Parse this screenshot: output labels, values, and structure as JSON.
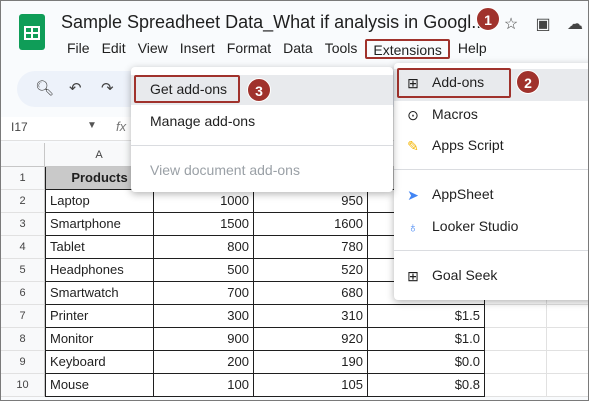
{
  "doc": {
    "title": "Sample Spreadheet Data_What if analysis in Googl..."
  },
  "menubar": [
    "File",
    "Edit",
    "View",
    "Insert",
    "Format",
    "Data",
    "Tools",
    "Extensions",
    "Help"
  ],
  "namebox": "I17",
  "fx": "fx",
  "columns": [
    "A"
  ],
  "rows": [
    {
      "n": "1",
      "a": "Products",
      "b": "",
      "c": "",
      "d": "",
      "header": true
    },
    {
      "n": "2",
      "a": "Laptop",
      "b": "1000",
      "c": "950",
      "d": ""
    },
    {
      "n": "3",
      "a": "Smartphone",
      "b": "1500",
      "c": "1600",
      "d": ""
    },
    {
      "n": "4",
      "a": "Tablet",
      "b": "800",
      "c": "780",
      "d": ""
    },
    {
      "n": "5",
      "a": "Headphones",
      "b": "500",
      "c": "520",
      "d": ""
    },
    {
      "n": "6",
      "a": "Smartwatch",
      "b": "700",
      "c": "680",
      "d": ""
    },
    {
      "n": "7",
      "a": "Printer",
      "b": "300",
      "c": "310",
      "d": "$1.5"
    },
    {
      "n": "8",
      "a": "Monitor",
      "b": "900",
      "c": "920",
      "d": "$1.0"
    },
    {
      "n": "9",
      "a": "Keyboard",
      "b": "200",
      "c": "190",
      "d": "$0.0"
    },
    {
      "n": "10",
      "a": "Mouse",
      "b": "100",
      "c": "105",
      "d": "$0.8"
    }
  ],
  "extensions_menu": {
    "items": [
      "Add-ons",
      "Macros",
      "Apps Script",
      "AppSheet",
      "Looker Studio",
      "Goal Seek"
    ]
  },
  "addons_menu": {
    "items": [
      "Get add-ons",
      "Manage add-ons",
      "View document add-ons"
    ]
  },
  "badges": [
    "1",
    "2",
    "3"
  ],
  "colors": {
    "highlight": "#a0322c",
    "header_fill": "#c9c9c9"
  }
}
